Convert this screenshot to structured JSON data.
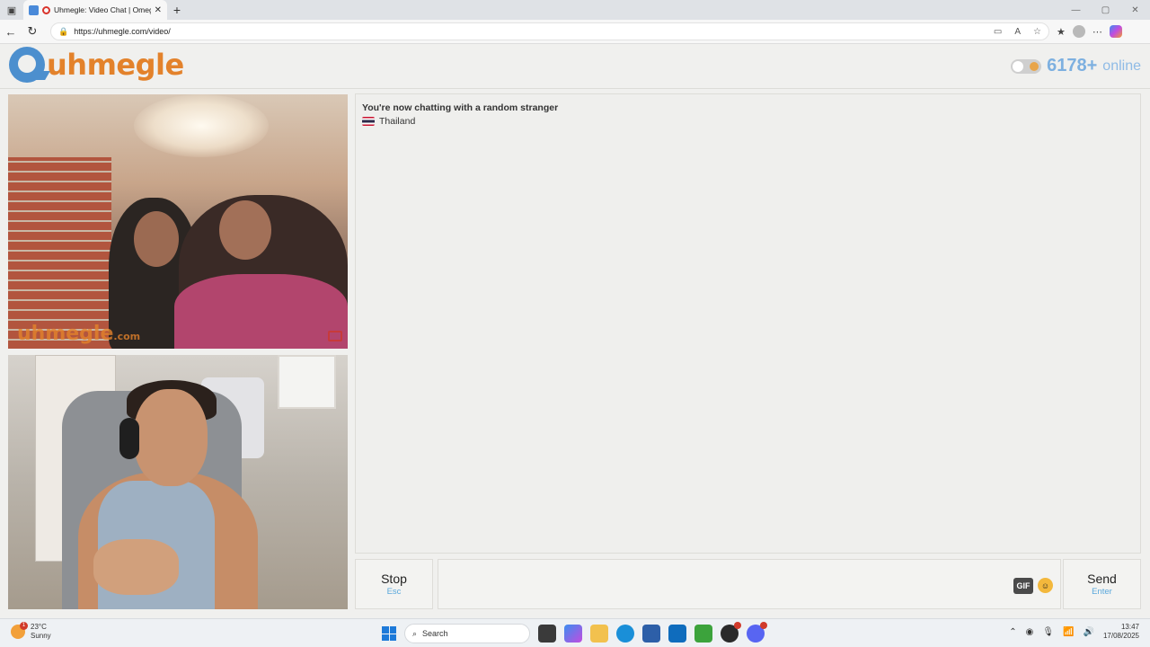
{
  "browser": {
    "tab_title": "Uhmegle: Video Chat | Omegle",
    "url": "https://uhmegle.com/video/"
  },
  "site": {
    "logo_text": "uhmegle",
    "online_count": "6178+",
    "online_label": "online"
  },
  "video": {
    "watermark": "uhmegle",
    "watermark_suffix": ".com"
  },
  "chat": {
    "status": "You're now chatting with a random stranger",
    "country": "Thailand"
  },
  "controls": {
    "stop_label": "Stop",
    "stop_shortcut": "Esc",
    "send_label": "Send",
    "send_shortcut": "Enter",
    "gif_label": "GIF"
  },
  "taskbar": {
    "temperature": "23°C",
    "weather": "Sunny",
    "weather_badge": "1",
    "search_placeholder": "Search",
    "time": "13:47",
    "date": "17/08/2025"
  },
  "colors": {
    "brand_orange": "#e3822b",
    "brand_blue": "#4c8fce",
    "online_blue": "#7db0e0",
    "shortcut_blue": "#5aa8dc"
  }
}
